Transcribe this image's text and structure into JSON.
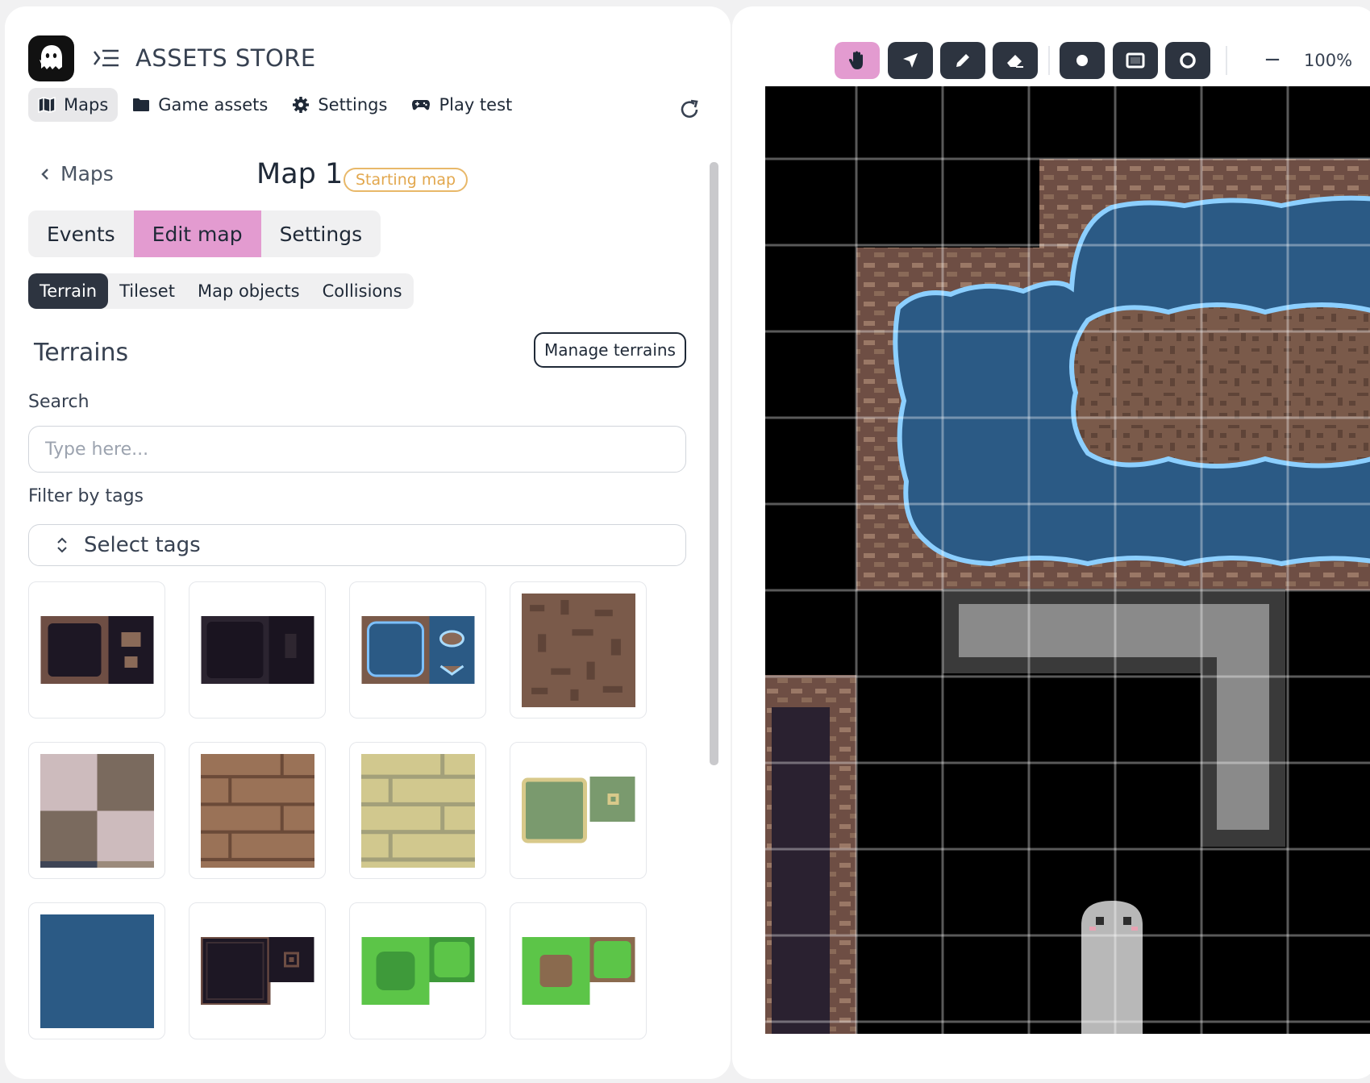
{
  "app": {
    "title": "ASSETS STORE"
  },
  "topnav": [
    {
      "label": "Maps",
      "icon": "map-icon",
      "active": true
    },
    {
      "label": "Game assets",
      "icon": "folder-icon",
      "active": false
    },
    {
      "label": "Settings",
      "icon": "gear-icon",
      "active": false
    },
    {
      "label": "Play test",
      "icon": "gamepad-icon",
      "active": false
    }
  ],
  "breadcrumb": {
    "back_label": "Maps"
  },
  "map": {
    "title": "Map 1",
    "badge": "Starting map"
  },
  "main_tabs": [
    {
      "label": "Events",
      "active": false
    },
    {
      "label": "Edit map",
      "active": true
    },
    {
      "label": "Settings",
      "active": false
    }
  ],
  "sub_tabs": [
    {
      "label": "Terrain",
      "active": true
    },
    {
      "label": "Tileset",
      "active": false
    },
    {
      "label": "Map objects",
      "active": false
    },
    {
      "label": "Collisions",
      "active": false
    }
  ],
  "terrains": {
    "title": "Terrains",
    "manage_label": "Manage terrains",
    "search_label": "Search",
    "search_placeholder": "Type here...",
    "filter_label": "Filter by tags",
    "filter_placeholder": "Select tags"
  },
  "terrain_tiles": [
    "cave-dirt-pit",
    "dark-pit",
    "water-pond",
    "dirt",
    "checker-stone",
    "brown-bricks",
    "yellow-bricks",
    "grass-platform",
    "deep-water",
    "dark-frame",
    "grass-bush",
    "grass-dirt-patch"
  ],
  "toolbar": {
    "tools": [
      {
        "name": "pan-tool",
        "icon": "hand-icon",
        "active": true
      },
      {
        "name": "select-tool",
        "icon": "arrow-icon",
        "active": false
      },
      {
        "name": "pencil-tool",
        "icon": "pencil-icon",
        "active": false
      },
      {
        "name": "eraser-tool",
        "icon": "eraser-icon",
        "active": false
      },
      {
        "name": "point-tool",
        "icon": "dot-icon",
        "active": false
      },
      {
        "name": "rectangle-tool",
        "icon": "rectangle-icon",
        "active": false
      },
      {
        "name": "ellipse-tool",
        "icon": "circle-icon",
        "active": false
      }
    ],
    "zoom": "100%"
  },
  "colors": {
    "accent_pink": "#e39bd0",
    "dark": "#2d3440",
    "badge_orange": "#e2a74d",
    "water": "#2b5a85",
    "dirt": "#7a5a4a"
  }
}
